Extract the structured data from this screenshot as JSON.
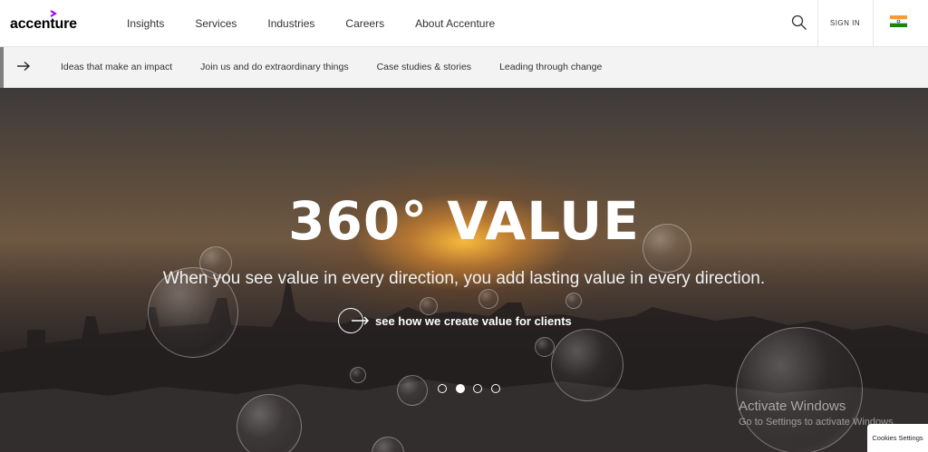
{
  "brand": {
    "logo_text": "accenture",
    "accent_color": "#a100ff"
  },
  "nav": {
    "links": [
      "Insights",
      "Services",
      "Industries",
      "Careers",
      "About Accenture"
    ],
    "search_icon": "search-icon",
    "sign_in": "SIGN IN",
    "region_icon": "india-flag-icon"
  },
  "subnav": {
    "arrow_icon": "arrow-right-icon",
    "links": [
      "Ideas that make an impact",
      "Join us and do extraordinary things",
      "Case studies & stories",
      "Leading through change"
    ]
  },
  "hero": {
    "title": "360° VALUE",
    "subtitle": "When you see value in every direction, you add lasting value in every direction.",
    "cta_label": "see how we create value for clients",
    "carousel": {
      "count": 4,
      "active": 2
    }
  },
  "watermark": {
    "title": "Activate Windows",
    "subtitle": "Go to Settings to activate Windows."
  },
  "cookies": {
    "label": "Cookies Settings"
  }
}
